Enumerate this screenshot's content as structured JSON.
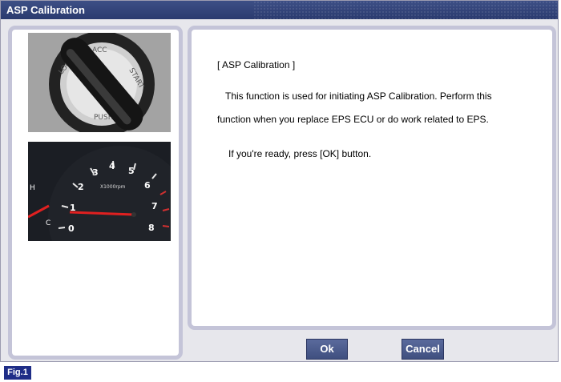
{
  "window": {
    "title": "ASP Calibration"
  },
  "message": {
    "heading": "[ ASP Calibration ]",
    "line1": "This function is used for initiating ASP Calibration. Perform this",
    "line2": "function when you replace EPS ECU or do work related to EPS.",
    "line3": "If you're ready, press [OK] button."
  },
  "images": {
    "ignition": {
      "labels": [
        "LOCK",
        "ACC",
        "START",
        "PUSH"
      ]
    },
    "tachometer": {
      "unit": "X1000rpm",
      "numbers": [
        "0",
        "1",
        "2",
        "3",
        "4",
        "5",
        "6",
        "7",
        "8"
      ],
      "left_labels": [
        "H",
        "C"
      ]
    }
  },
  "buttons": {
    "ok": "Ok",
    "cancel": "Cancel"
  },
  "figure_label": "Fig.1",
  "colors": {
    "title_bar": "#2f3f76",
    "button": "#4a5a8c",
    "panel_border": "#c4c4d8"
  }
}
